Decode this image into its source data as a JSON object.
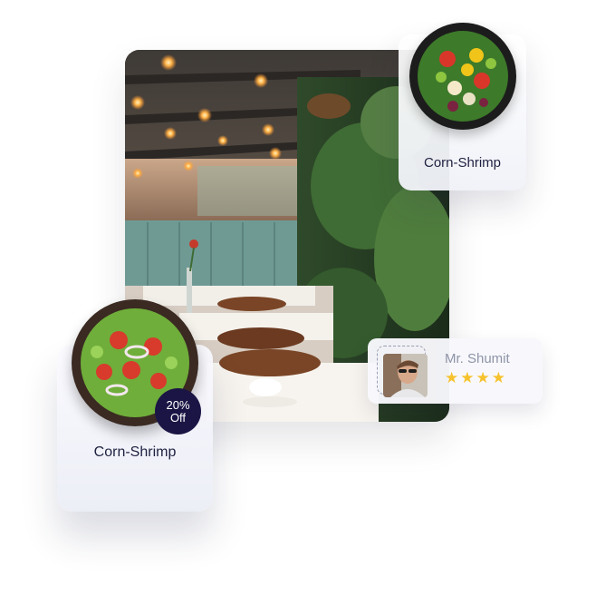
{
  "top_card": {
    "dish_name": "Corn-Shrimp",
    "image": "salad-bowl-image"
  },
  "left_card": {
    "dish_name": "Corn-Shrimp",
    "discount_percent": "20%",
    "discount_label": "Off",
    "image": "salad-bowl-image"
  },
  "review_card": {
    "reviewer_name": "Mr. Shumit",
    "rating": 4,
    "rating_max": 4,
    "star_color": "#f6c22d",
    "avatar": "reviewer-avatar"
  },
  "hero": {
    "image": "restaurant-interior-image"
  },
  "colors": {
    "badge_background": "#1b1545",
    "text_primary": "#1f2040",
    "text_secondary": "#8e94a8"
  }
}
